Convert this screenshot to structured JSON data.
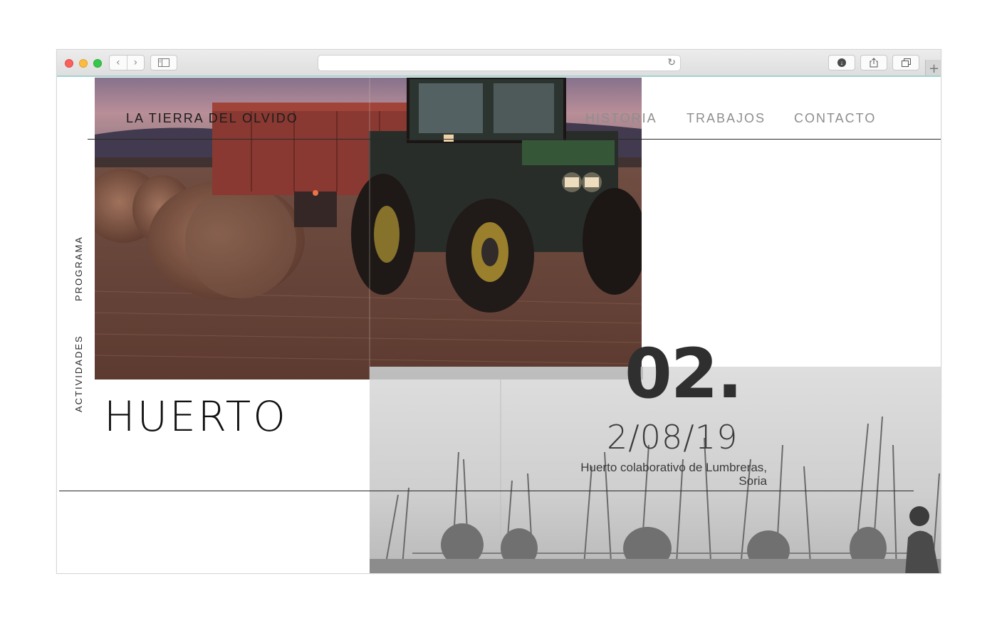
{
  "browser": {
    "url": "",
    "icons": {
      "back": "chevron-left-icon",
      "forward": "chevron-right-icon",
      "sidebar": "sidebar-icon",
      "reload": "reload-icon",
      "download": "download-icon",
      "share": "share-icon",
      "tabs": "tabs-icon",
      "new_tab": "plus-icon"
    }
  },
  "site": {
    "brand": "LA TIERRA DEL OLVIDO",
    "nav": [
      "HISTORIA",
      "TRABAJOS",
      "CONTACTO"
    ],
    "side_menu": [
      "PROGRAMA",
      "ACTIVIDADES"
    ]
  },
  "event": {
    "title": "HUERTO",
    "number": "02.",
    "date": "2/08/19",
    "location_line1": "Huerto colaborativo de Lumbreras,",
    "location_line2": "Soria"
  },
  "colors": {
    "nav_text": "#8e8e8e",
    "brand_text": "#1c1c1c",
    "rule": "#2a2a2a",
    "toolbar_accent": "#9fd3cf"
  }
}
